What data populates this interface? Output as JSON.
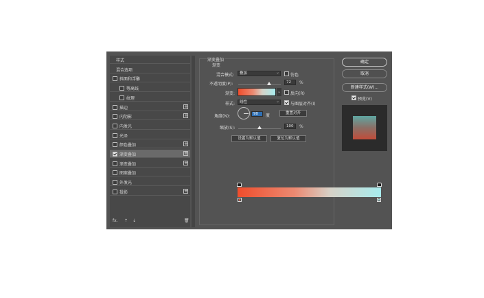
{
  "styles_list": {
    "items": [
      {
        "label": "样式",
        "checkbox": false,
        "checked": false,
        "plus": false
      },
      {
        "label": "混合选项",
        "checkbox": false,
        "checked": false,
        "plus": false
      },
      {
        "label": "斜面和浮雕",
        "checkbox": true,
        "checked": false,
        "plus": false
      },
      {
        "label": "等高线",
        "checkbox": true,
        "checked": false,
        "plus": false,
        "indent": true
      },
      {
        "label": "纹理",
        "checkbox": true,
        "checked": false,
        "plus": false,
        "indent": true
      },
      {
        "label": "描边",
        "checkbox": true,
        "checked": false,
        "plus": true
      },
      {
        "label": "内阴影",
        "checkbox": true,
        "checked": false,
        "plus": true
      },
      {
        "label": "内发光",
        "checkbox": true,
        "checked": false,
        "plus": false
      },
      {
        "label": "光泽",
        "checkbox": true,
        "checked": false,
        "plus": false
      },
      {
        "label": "颜色叠加",
        "checkbox": true,
        "checked": false,
        "plus": true
      },
      {
        "label": "渐变叠加",
        "checkbox": true,
        "checked": true,
        "plus": true,
        "highlight": true
      },
      {
        "label": "渐变叠加",
        "checkbox": true,
        "checked": false,
        "plus": true
      },
      {
        "label": "图案叠加",
        "checkbox": true,
        "checked": false,
        "plus": false
      },
      {
        "label": "外发光",
        "checkbox": true,
        "checked": false,
        "plus": false
      },
      {
        "label": "投影",
        "checkbox": true,
        "checked": false,
        "plus": true
      }
    ],
    "bottom_icons": {
      "fx": "fx.",
      "up": "⇡",
      "down": "⇣",
      "trash": "🗑"
    }
  },
  "panel": {
    "title": "渐变叠加",
    "subtitle": "渐变",
    "blend_mode_label": "混合模式:",
    "blend_mode_value": "叠加",
    "dither_label": "仿色",
    "opacity_label": "不透明度(P):",
    "opacity_value": "72",
    "opacity_unit": "%",
    "opacity_level": 0.72,
    "gradient_label": "渐变:",
    "reverse_label": "反向(R)",
    "style_label": "样式:",
    "style_value": "线性",
    "align_label": "与图层对齐(I)",
    "angle_label": "角度(N):",
    "angle_value": "90",
    "angle_unit": "度",
    "reset_align": "重置对齐",
    "scale_label": "缩放(S):",
    "scale_value": "100",
    "scale_unit": "%",
    "scale_level": 0.5,
    "set_default": "设置为默认值",
    "reset_default": "复位为默认值"
  },
  "colors": {
    "start": "#ef4d2c",
    "end": "#a7ecee"
  },
  "buttons": {
    "ok": "确定",
    "cancel": "取消",
    "new_style": "新建样式(W)...",
    "preview": "预览(V)"
  }
}
